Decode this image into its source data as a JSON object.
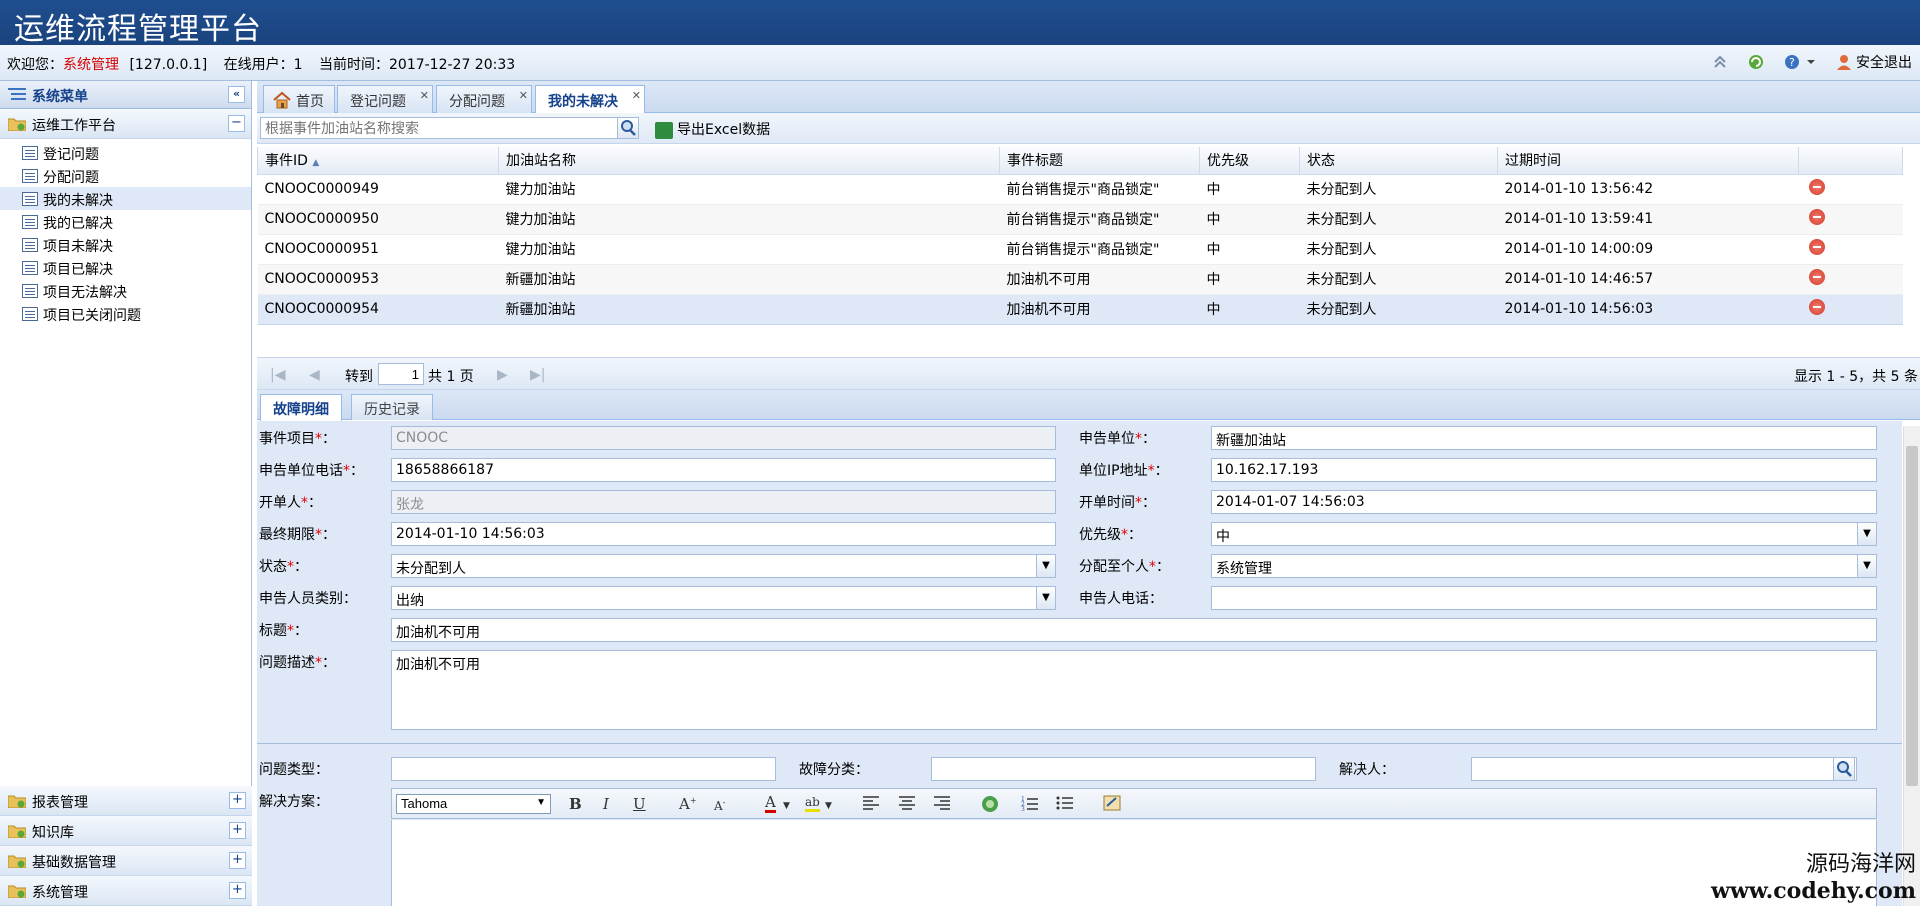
{
  "app": {
    "title": "运维流程管理平台"
  },
  "info": {
    "welcome": "欢迎您：",
    "user": "系统管理",
    "ip": "[127.0.0.1]",
    "online": "在线用户：1",
    "time": "当前时间：2017-12-27 20:33",
    "logout": "安全退出"
  },
  "sidebar": {
    "header": "系统菜单",
    "group": "运维工作平台",
    "items": [
      "登记问题",
      "分配问题",
      "我的未解决",
      "我的已解决",
      "项目未解决",
      "项目已解决",
      "项目无法解决",
      "项目已关闭问题"
    ],
    "active_index": 2,
    "bottom_groups": [
      "报表管理",
      "知识库",
      "基础数据管理",
      "系统管理"
    ]
  },
  "tabs": [
    "首页",
    "登记问题",
    "分配问题",
    "我的未解决"
  ],
  "toolbar": {
    "search_placeholder": "根据事件加油站名称搜索",
    "export": "导出Excel数据"
  },
  "grid": {
    "columns": [
      "事件ID",
      "加油站名称",
      "事件标题",
      "优先级",
      "状态",
      "过期时间"
    ],
    "rows": [
      [
        "CNOOC0000949",
        "键力加油站",
        "前台销售提示\"商品锁定\"",
        "中",
        "未分配到人",
        "2014-01-10 13:56:42"
      ],
      [
        "CNOOC0000950",
        "键力加油站",
        "前台销售提示\"商品锁定\"",
        "中",
        "未分配到人",
        "2014-01-10 13:59:41"
      ],
      [
        "CNOOC0000951",
        "键力加油站",
        "前台销售提示\"商品锁定\"",
        "中",
        "未分配到人",
        "2014-01-10 14:00:09"
      ],
      [
        "CNOOC0000953",
        "新疆加油站",
        "加油机不可用",
        "中",
        "未分配到人",
        "2014-01-10 14:46:57"
      ],
      [
        "CNOOC0000954",
        "新疆加油站",
        "加油机不可用",
        "中",
        "未分配到人",
        "2014-01-10 14:56:03"
      ]
    ],
    "selected_row": 4
  },
  "pager": {
    "goto": "转到",
    "page": "1",
    "total": "共 1 页",
    "display": "显示 1 - 5，共 5 条"
  },
  "detail_tabs": [
    "故障明细",
    "历史记录"
  ],
  "form": {
    "event_project": {
      "label": "事件项目",
      "value": "CNOOC"
    },
    "report_unit": {
      "label": "申告单位",
      "value": "新疆加油站"
    },
    "unit_phone": {
      "label": "申告单位电话",
      "value": "18658866187"
    },
    "unit_ip": {
      "label": "单位IP地址",
      "value": "10.162.17.193"
    },
    "opener": {
      "label": "开单人",
      "value": "张龙"
    },
    "open_time": {
      "label": "开单时间",
      "value": "2014-01-07 14:56:03"
    },
    "deadline": {
      "label": "最终期限",
      "value": "2014-01-10 14:56:03"
    },
    "priority": {
      "label": "优先级",
      "value": "中"
    },
    "status": {
      "label": "状态",
      "value": "未分配到人"
    },
    "assign_to": {
      "label": "分配至个人",
      "value": "系统管理"
    },
    "reporter_type": {
      "label": "申告人员类别：",
      "value": "出纳"
    },
    "reporter_phone": {
      "label": "申告人电话：",
      "value": ""
    },
    "title": {
      "label": "标题",
      "value": "加油机不可用"
    },
    "description": {
      "label": "问题描述",
      "value": "加油机不可用"
    },
    "problem_type": {
      "label": "问题类型：",
      "value": ""
    },
    "fault_class": {
      "label": "故障分类：",
      "value": ""
    },
    "resolver": {
      "label": "解决人：",
      "value": ""
    },
    "solution": {
      "label": "解决方案："
    },
    "editor_font": "Tahoma"
  },
  "watermark": {
    "line1": "源码海洋网",
    "line2": "www.codehy.com"
  }
}
